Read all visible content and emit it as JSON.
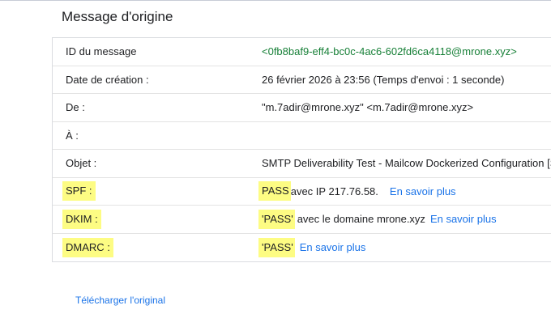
{
  "header": {
    "title": "Message d'origine"
  },
  "details": {
    "message_id": {
      "label": "ID du message",
      "value": "<0fb8baf9-eff4-bc0c-4ac6-602fd6ca4118@mrone.xyz>"
    },
    "created": {
      "label": "Date de création :",
      "value": "26 février 2026 à 23:56 (Temps d'envoi : 1 seconde)"
    },
    "from": {
      "label": "De :",
      "value": "\"m.7adir@mrone.xyz\" <m.7adir@mrone.xyz>"
    },
    "to": {
      "label": "À :",
      "value": ""
    },
    "subject": {
      "label": "Objet :",
      "value": "SMTP Deliverability Test - Mailcow Dockerized Configuration [S"
    },
    "spf": {
      "label": "SPF :",
      "status": "PASS",
      "detail": "avec IP 217.76.58.",
      "link": "En savoir plus"
    },
    "dkim": {
      "label": "DKIM :",
      "status": "'PASS'",
      "detail": "avec le domaine mrone.xyz",
      "link": "En savoir plus"
    },
    "dmarc": {
      "label": "DMARC :",
      "status": "'PASS'",
      "link": "En savoir plus"
    }
  },
  "footer": {
    "download_label": "Télécharger l'original"
  },
  "colors": {
    "highlight": "#fdfc83",
    "link": "#1a73e8",
    "message_id": "#188038"
  }
}
